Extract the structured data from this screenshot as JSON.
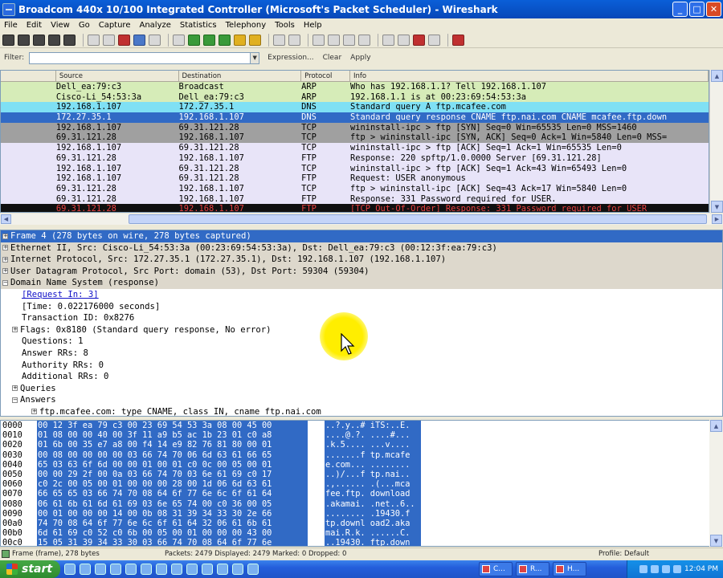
{
  "window": {
    "title": "Broadcom 440x 10/100 Integrated Controller (Microsoft's Packet Scheduler)  - Wireshark"
  },
  "menu": [
    "File",
    "Edit",
    "View",
    "Go",
    "Capture",
    "Analyze",
    "Statistics",
    "Telephony",
    "Tools",
    "Help"
  ],
  "filter": {
    "label": "Filter:",
    "value": "",
    "expression": "Expression...",
    "clear": "Clear",
    "apply": "Apply"
  },
  "packet_list": {
    "columns": [
      "Source",
      "Destination",
      "Protocol",
      "Info"
    ],
    "rows": [
      {
        "src": "Dell_ea:79:c3",
        "dst": "Broadcast",
        "proto": "ARP",
        "info": "Who has 192.168.1.1?  Tell 192.168.1.107",
        "bg": "#d6ecb8",
        "fg": "#000000"
      },
      {
        "src": "Cisco-Li_54:53:3a",
        "dst": "Dell_ea:79:c3",
        "proto": "ARP",
        "info": "192.168.1.1 is at 00:23:69:54:53:3a",
        "bg": "#d6ecb8",
        "fg": "#000000"
      },
      {
        "src": "192.168.1.107",
        "dst": "172.27.35.1",
        "proto": "DNS",
        "info": "Standard query A ftp.mcafee.com",
        "bg": "#7fe0f4",
        "fg": "#000000"
      },
      {
        "src": "172.27.35.1",
        "dst": "192.168.1.107",
        "proto": "DNS",
        "info": "Standard query response CNAME ftp.nai.com CNAME mcafee.ftp.down",
        "bg": "#316ac5",
        "fg": "#ffffff"
      },
      {
        "src": "192.168.1.107",
        "dst": "69.31.121.28",
        "proto": "TCP",
        "info": "wininstall-ipc > ftp [SYN] Seq=0 Win=65535 Len=0 MSS=1460",
        "bg": "#a0a0a0",
        "fg": "#000000"
      },
      {
        "src": "69.31.121.28",
        "dst": "192.168.1.107",
        "proto": "TCP",
        "info": "ftp > wininstall-ipc [SYN, ACK] Seq=0 Ack=1 Win=5840 Len=0 MSS=",
        "bg": "#a0a0a0",
        "fg": "#000000"
      },
      {
        "src": "192.168.1.107",
        "dst": "69.31.121.28",
        "proto": "TCP",
        "info": "wininstall-ipc > ftp [ACK] Seq=1 Ack=1 Win=65535 Len=0",
        "bg": "#e8e4f8",
        "fg": "#000000"
      },
      {
        "src": "69.31.121.28",
        "dst": "192.168.1.107",
        "proto": "FTP",
        "info": "Response: 220 spftp/1.0.0000 Server [69.31.121.28]",
        "bg": "#e8e4f8",
        "fg": "#000000"
      },
      {
        "src": "192.168.1.107",
        "dst": "69.31.121.28",
        "proto": "TCP",
        "info": "wininstall-ipc > ftp [ACK] Seq=1 Ack=43 Win=65493 Len=0",
        "bg": "#e8e4f8",
        "fg": "#000000"
      },
      {
        "src": "192.168.1.107",
        "dst": "69.31.121.28",
        "proto": "FTP",
        "info": "Request: USER anonymous",
        "bg": "#e8e4f8",
        "fg": "#000000"
      },
      {
        "src": "69.31.121.28",
        "dst": "192.168.1.107",
        "proto": "TCP",
        "info": "ftp > wininstall-ipc [ACK] Seq=43 Ack=17 Win=5840 Len=0",
        "bg": "#e8e4f8",
        "fg": "#000000"
      },
      {
        "src": "69.31.121.28",
        "dst": "192.168.1.107",
        "proto": "FTP",
        "info": "Response: 331 Password required for USER.",
        "bg": "#e8e4f8",
        "fg": "#000000"
      },
      {
        "src": "69.31.121.28",
        "dst": "192.168.1.107",
        "proto": "FTP",
        "info": "[TCP Out-Of-Order] Response: 331 Password required for USER",
        "bg": "#101010",
        "fg": "#e84040"
      }
    ]
  },
  "details": {
    "rows": [
      {
        "text": "Frame 4 (278 bytes on wire, 278 bytes captured)",
        "indent": 0,
        "expander": "+",
        "style": "sel"
      },
      {
        "text": "Ethernet II, Src: Cisco-Li_54:53:3a (00:23:69:54:53:3a), Dst: Dell_ea:79:c3 (00:12:3f:ea:79:c3)",
        "indent": 0,
        "expander": "+",
        "style": "hdr"
      },
      {
        "text": "Internet Protocol, Src: 172.27.35.1 (172.27.35.1), Dst: 192.168.1.107 (192.168.1.107)",
        "indent": 0,
        "expander": "+",
        "style": "hdr"
      },
      {
        "text": "User Datagram Protocol, Src Port: domain (53), Dst Port: 59304 (59304)",
        "indent": 0,
        "expander": "+",
        "style": "hdr"
      },
      {
        "text": "Domain Name System (response)",
        "indent": 0,
        "expander": "-",
        "style": "hdr"
      },
      {
        "text": "[Request In: 3]",
        "indent": 2,
        "expander": "",
        "style": "link"
      },
      {
        "text": "[Time: 0.022176000 seconds]",
        "indent": 2,
        "expander": "",
        "style": ""
      },
      {
        "text": "Transaction ID: 0x8276",
        "indent": 2,
        "expander": "",
        "style": ""
      },
      {
        "text": "Flags: 0x8180 (Standard query response, No error)",
        "indent": 1,
        "expander": "+",
        "style": ""
      },
      {
        "text": "Questions: 1",
        "indent": 2,
        "expander": "",
        "style": ""
      },
      {
        "text": "Answer RRs: 8",
        "indent": 2,
        "expander": "",
        "style": ""
      },
      {
        "text": "Authority RRs: 0",
        "indent": 2,
        "expander": "",
        "style": ""
      },
      {
        "text": "Additional RRs: 0",
        "indent": 2,
        "expander": "",
        "style": ""
      },
      {
        "text": "Queries",
        "indent": 1,
        "expander": "+",
        "style": ""
      },
      {
        "text": "Answers",
        "indent": 1,
        "expander": "-",
        "style": ""
      },
      {
        "text": "ftp.mcafee.com: type CNAME, class IN, cname ftp.nai.com",
        "indent": 3,
        "expander": "+",
        "style": ""
      }
    ]
  },
  "bytes": {
    "rows": [
      {
        "offset": "0000",
        "hex": "00 12 3f ea 79 c3 00 23  69 54 53 3a 08 00 45 00",
        "ascii": "..?.y..# iTS:..E."
      },
      {
        "offset": "0010",
        "hex": "01 08 00 00 40 00 3f 11  a9 b5 ac 1b 23 01 c0 a8",
        "ascii": "....@.?. ....#..."
      },
      {
        "offset": "0020",
        "hex": "01 6b 00 35 e7 a8 00 f4  14 e9 82 76 81 80 00 01",
        "ascii": ".k.5.... ...v...."
      },
      {
        "offset": "0030",
        "hex": "00 08 00 00 00 00 03 66  74 70 06 6d 63 61 66 65",
        "ascii": ".......f tp.mcafe"
      },
      {
        "offset": "0040",
        "hex": "65 03 63 6f 6d 00 00 01  00 01 c0 0c 00 05 00 01",
        "ascii": "e.com... ........"
      },
      {
        "offset": "0050",
        "hex": "00 00 29 2f 00 0a 03 66  74 70 03 6e 61 69 c0 17",
        "ascii": "..)/...f tp.nai.."
      },
      {
        "offset": "0060",
        "hex": "c0 2c 00 05 00 01 00 00  00 28 00 1d 06 6d 63 61",
        "ascii": ".,...... .(...mca"
      },
      {
        "offset": "0070",
        "hex": "66 65 65 03 66 74 70 08  64 6f 77 6e 6c 6f 61 64",
        "ascii": "fee.ftp. download"
      },
      {
        "offset": "0080",
        "hex": "06 61 6b 61 6d 61 69 03  6e 65 74 00 c0 36 00 05",
        "ascii": ".akamai. .net..6.."
      },
      {
        "offset": "0090",
        "hex": "00 01 00 00 00 14 00 0b  08 31 39 34 33 30 2e 66",
        "ascii": "........ .19430.f"
      },
      {
        "offset": "00a0",
        "hex": "74 70 08 64 6f 77 6e 6c  6f 61 64 32 06 61 6b 61",
        "ascii": "tp.downl oad2.aka"
      },
      {
        "offset": "00b0",
        "hex": "6d 61 69 c0 52 c0 6b 00  05 00 01 00 00 00 43 00",
        "ascii": "mai.R.k. ......C."
      },
      {
        "offset": "00c0",
        "hex": "15 05 31 39 34 33 30 03  66 74 70 08 64 6f 77 6e",
        "ascii": "..19430. ftp.down"
      }
    ]
  },
  "status": {
    "frame": "Frame (frame), 278 bytes",
    "packets": "Packets: 2479 Displayed: 2479 Marked: 0 Dropped: 0",
    "profile": "Profile: Default"
  },
  "taskbar": {
    "start": "start",
    "tasks": [
      "C...",
      "R...",
      "H..."
    ],
    "clock": "12:04 PM"
  }
}
